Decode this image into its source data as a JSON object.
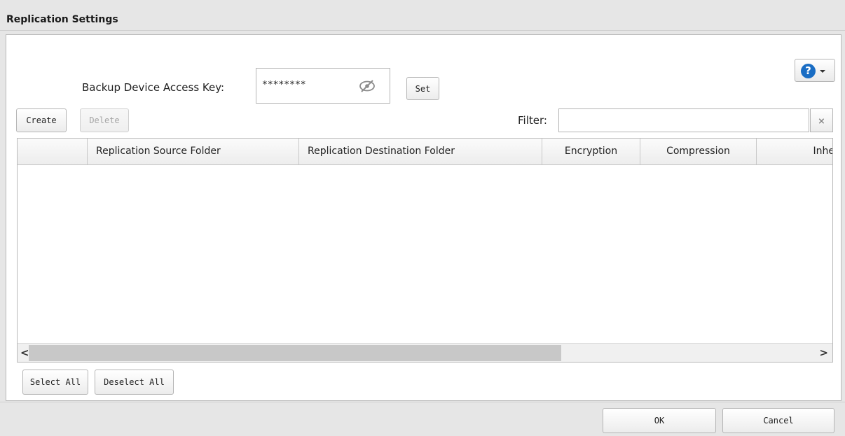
{
  "window": {
    "title": "Replication Settings"
  },
  "help": {
    "icon": "help-icon",
    "glyph": "?"
  },
  "access_key": {
    "label": "Backup Device Access Key:",
    "value": "********",
    "visibility_icon": "eye-slash-icon",
    "set_label": "Set"
  },
  "toolbar": {
    "create_label": "Create",
    "delete_label": "Delete"
  },
  "filter": {
    "label": "Filter:",
    "value": "",
    "clear_glyph": "×"
  },
  "table": {
    "columns": [
      "",
      "Replication Source Folder",
      "Replication Destination Folder",
      "Encryption",
      "Compression",
      "Inhe"
    ],
    "rows": []
  },
  "scrollbar": {
    "left_glyph": "<",
    "right_glyph": ">"
  },
  "selection": {
    "select_all_label": "Select All",
    "deselect_all_label": "Deselect All"
  },
  "footer": {
    "ok_label": "OK",
    "cancel_label": "Cancel"
  }
}
